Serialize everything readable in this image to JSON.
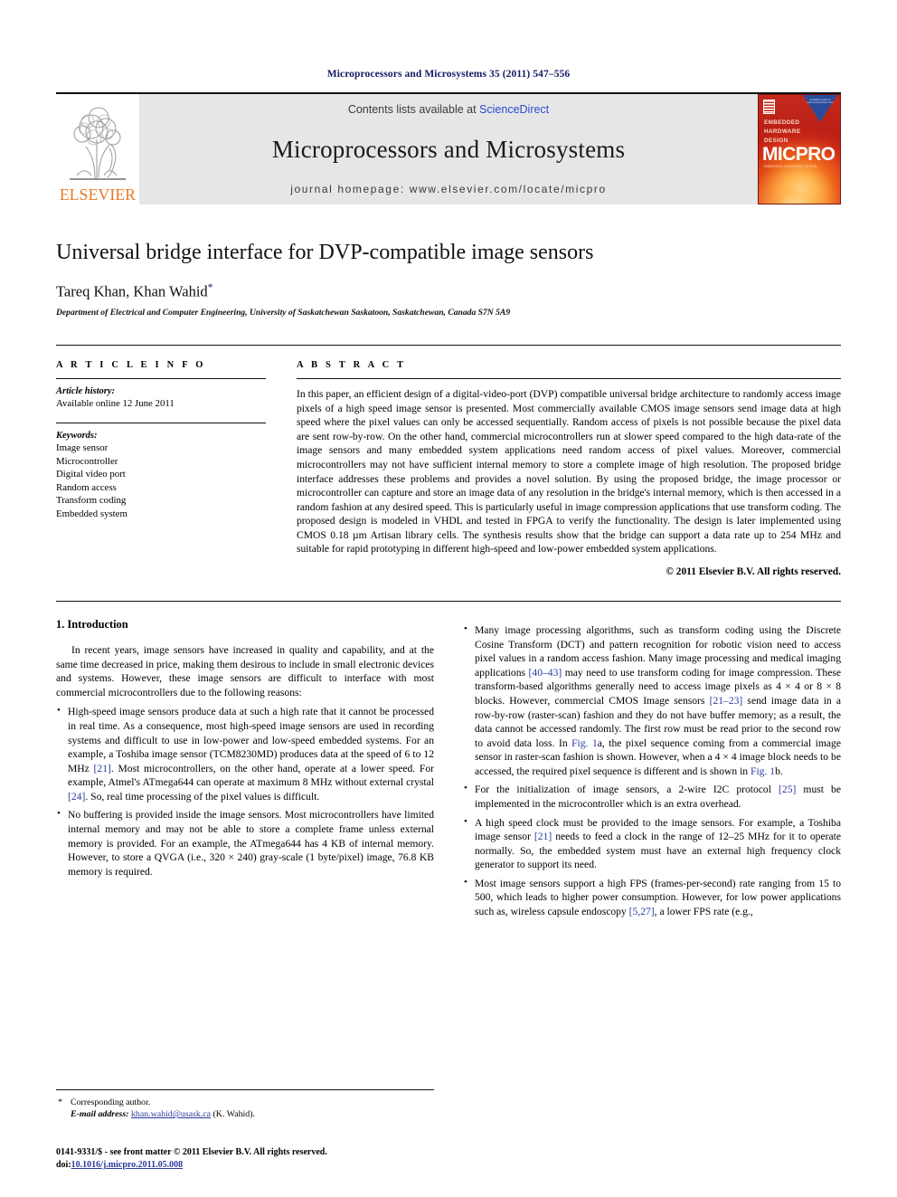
{
  "running_head": "Microprocessors and Microsystems 35 (2011) 547–556",
  "masthead": {
    "publisher_wordmark": "ELSEVIER",
    "contents_prefix": "Contents lists available at ",
    "contents_link": "ScienceDirect",
    "journal_title": "Microprocessors and Microsystems",
    "homepage": "journal homepage: www.elsevier.com/locate/micpro",
    "cover": {
      "tagline": "EMBEDDED\nHARDWARE\nDESIGN",
      "brand": "MICPRO",
      "subtitle": "EMBEDDED HARDWARE DESIGN",
      "badge": "Available online at www.sciencedirect.com"
    }
  },
  "article": {
    "title": "Universal bridge interface for DVP-compatible image sensors",
    "authors": "Tareq Khan, Khan Wahid",
    "corresponding_marker": "*",
    "affiliation": "Department of Electrical and Computer Engineering, University of Saskatchewan Saskatoon, Saskatchewan, Canada S7N 5A9"
  },
  "info": {
    "heading": "A R T I C L E    I N F O",
    "history_label": "Article history:",
    "history_value": "Available online 12 June 2011",
    "keywords_label": "Keywords:",
    "keywords": [
      "Image sensor",
      "Microcontroller",
      "Digital video port",
      "Random access",
      "Transform coding",
      "Embedded system"
    ]
  },
  "abstract": {
    "heading": "A B S T R A C T",
    "text": "In this paper, an efficient design of a digital-video-port (DVP) compatible universal bridge architecture to randomly access image pixels of a high speed image sensor is presented. Most commercially available CMOS image sensors send image data at high speed where the pixel values can only be accessed sequentially. Random access of pixels is not possible because the pixel data are sent row-by-row. On the other hand, commercial microcontrollers run at slower speed compared to the high data-rate of the image sensors and many embedded system applications need random access of pixel values. Moreover, commercial microcontrollers may not have sufficient internal memory to store a complete image of high resolution. The proposed bridge interface addresses these problems and provides a novel solution. By using the proposed bridge, the image processor or microcontroller can capture and store an image data of any resolution in the bridge's internal memory, which is then accessed in a random fashion at any desired speed. This is particularly useful in image compression applications that use transform coding. The proposed design is modeled in VHDL and tested in FPGA to verify the functionality. The design is later implemented using CMOS 0.18 µm Artisan library cells. The synthesis results show that the bridge can support a data rate up to 254 MHz and suitable for rapid prototyping in different high-speed and low-power embedded system applications.",
    "copyright": "© 2011 Elsevier B.V. All rights reserved."
  },
  "sections": {
    "intro_heading": "1. Introduction",
    "intro_para": "In recent years, image sensors have increased in quality and capability, and at the same time decreased in price, making them desirous to include in small electronic devices and systems. However, these image sensors are difficult to interface with most commercial microcontrollers due to the following reasons:",
    "left_bullets": [
      "High-speed image sensors produce data at such a high rate that it cannot be processed in real time. As a consequence, most high-speed image sensors are used in recording systems and difficult to use in low-power and low-speed embedded systems. For an example, a Toshiba image sensor (TCM8230MD) produces data at the speed of 6 to 12 MHz [21]. Most microcontrollers, on the other hand, operate at a lower speed. For example, Atmel's ATmega644 can operate at maximum 8 MHz without external crystal [24]. So, real time processing of the pixel values is difficult.",
      "No buffering is provided inside the image sensors. Most microcontrollers have limited internal memory and may not be able to store a complete frame unless external memory is provided. For an example, the ATmega644 has 4 KB of internal memory. However, to store a QVGA (i.e., 320 × 240) gray-scale (1 byte/pixel) image, 76.8 KB memory is required."
    ],
    "right_bullets": [
      "Many image processing algorithms, such as transform coding using the Discrete Cosine Transform (DCT) and pattern recognition for robotic vision need to access pixel values in a random access fashion. Many image processing and medical imaging applications [40–43] may need to use transform coding for image compression. These transform-based algorithms generally need to access image pixels as 4 × 4 or 8 × 8 blocks. However, commercial CMOS Image sensors [21–23] send image data in a row-by-row (raster-scan) fashion and they do not have buffer memory; as a result, the data cannot be accessed randomly. The first row must be read prior to the second row to avoid data loss. In Fig. 1a, the pixel sequence coming from a commercial image sensor in raster-scan fashion is shown. However, when a 4 × 4 image block needs to be accessed, the required pixel sequence is different and is shown in Fig. 1b.",
      "For the initialization of image sensors, a 2-wire I2C protocol [25] must be implemented in the microcontroller which is an extra overhead.",
      "A high speed clock must be provided to the image sensors. For example, a Toshiba image sensor [21] needs to feed a clock in the range of 12–25 MHz for it to operate normally. So, the embedded system must have an external high frequency clock generator to support its need.",
      "Most image sensors support a high FPS (frames-per-second) rate ranging from 15 to 500, which leads to higher power consumption. However, for low power applications such as, wireless capsule endoscopy [5,27], a lower FPS rate (e.g.,"
    ]
  },
  "footnotes": {
    "corresponding": "Corresponding author.",
    "email_label": "E-mail address:",
    "email": "khan.wahid@usask.ca",
    "email_suffix": "(K. Wahid)."
  },
  "colophon": {
    "issn_line": "0141-9331/$ - see front matter © 2011 Elsevier B.V. All rights reserved.",
    "doi_label": "doi:",
    "doi": "10.1016/j.micpro.2011.05.008"
  },
  "colors": {
    "link": "#2a3b9e",
    "elsevier_orange": "#e87722",
    "runhead": "#131a63",
    "banner_bg": "#e6e6e6"
  }
}
